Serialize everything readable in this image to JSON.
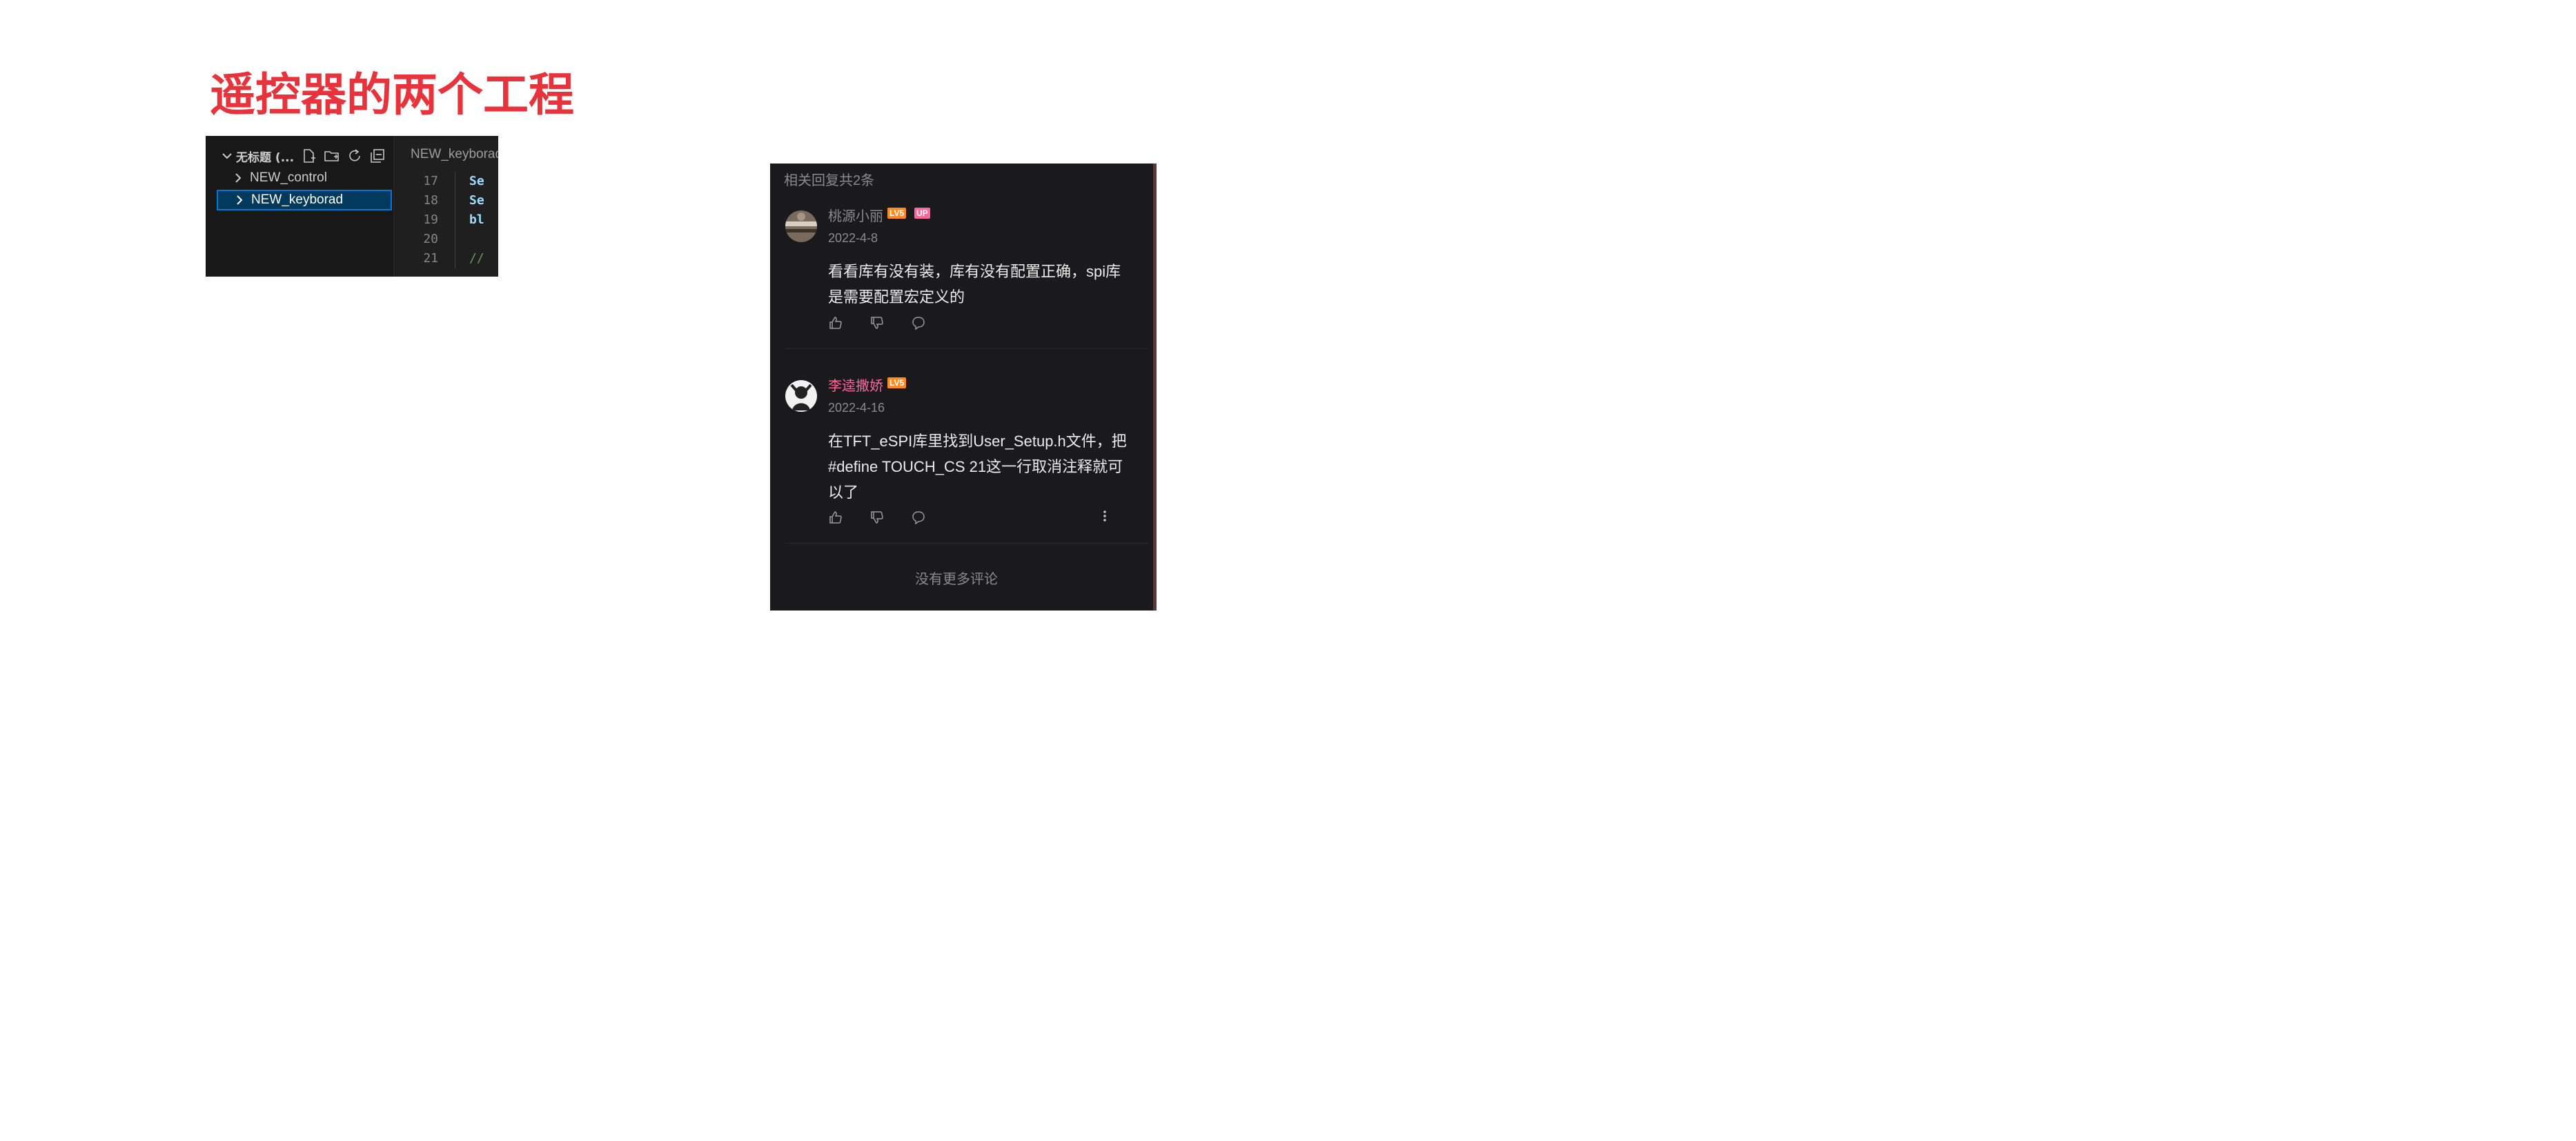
{
  "page_title": "遥控器的两个工程",
  "vscode": {
    "workspace_title": "无标题 (...",
    "tree": [
      {
        "label": "NEW_control",
        "selected": false
      },
      {
        "label": "NEW_keyborad",
        "selected": true
      }
    ],
    "tab_label": "NEW_keyborad",
    "lines": [
      {
        "number": "17",
        "code": "Se"
      },
      {
        "number": "18",
        "code": "Se"
      },
      {
        "number": "19",
        "code": "bl"
      },
      {
        "number": "20",
        "code": ""
      },
      {
        "number": "21",
        "code": "//"
      }
    ],
    "icons": [
      "new-file-icon",
      "new-folder-icon",
      "refresh-icon",
      "collapse-all-icon"
    ]
  },
  "comments_panel": {
    "reply_count": "相关回复共2条",
    "comments": [
      {
        "username": "桃源小丽",
        "level_badge": "LV5",
        "up_badge": "UP",
        "date": "2022-4-8",
        "text": "看看库有没有装，库有没有配置正确，spi库是需要配置宏定义的"
      },
      {
        "username": "李逵撒娇",
        "level_badge": "LV5",
        "date": "2022-4-16",
        "text": "在TFT_eSPI库里找到User_Setup.h文件，把#define TOUCH_CS 21这一行取消注释就可以了"
      }
    ],
    "end_text": "没有更多评论",
    "colors": {
      "background": "#1a1a1c",
      "pink_name": "#ff6699",
      "level_badge": "#ff8a1f",
      "title_red": "#e8323c"
    }
  }
}
